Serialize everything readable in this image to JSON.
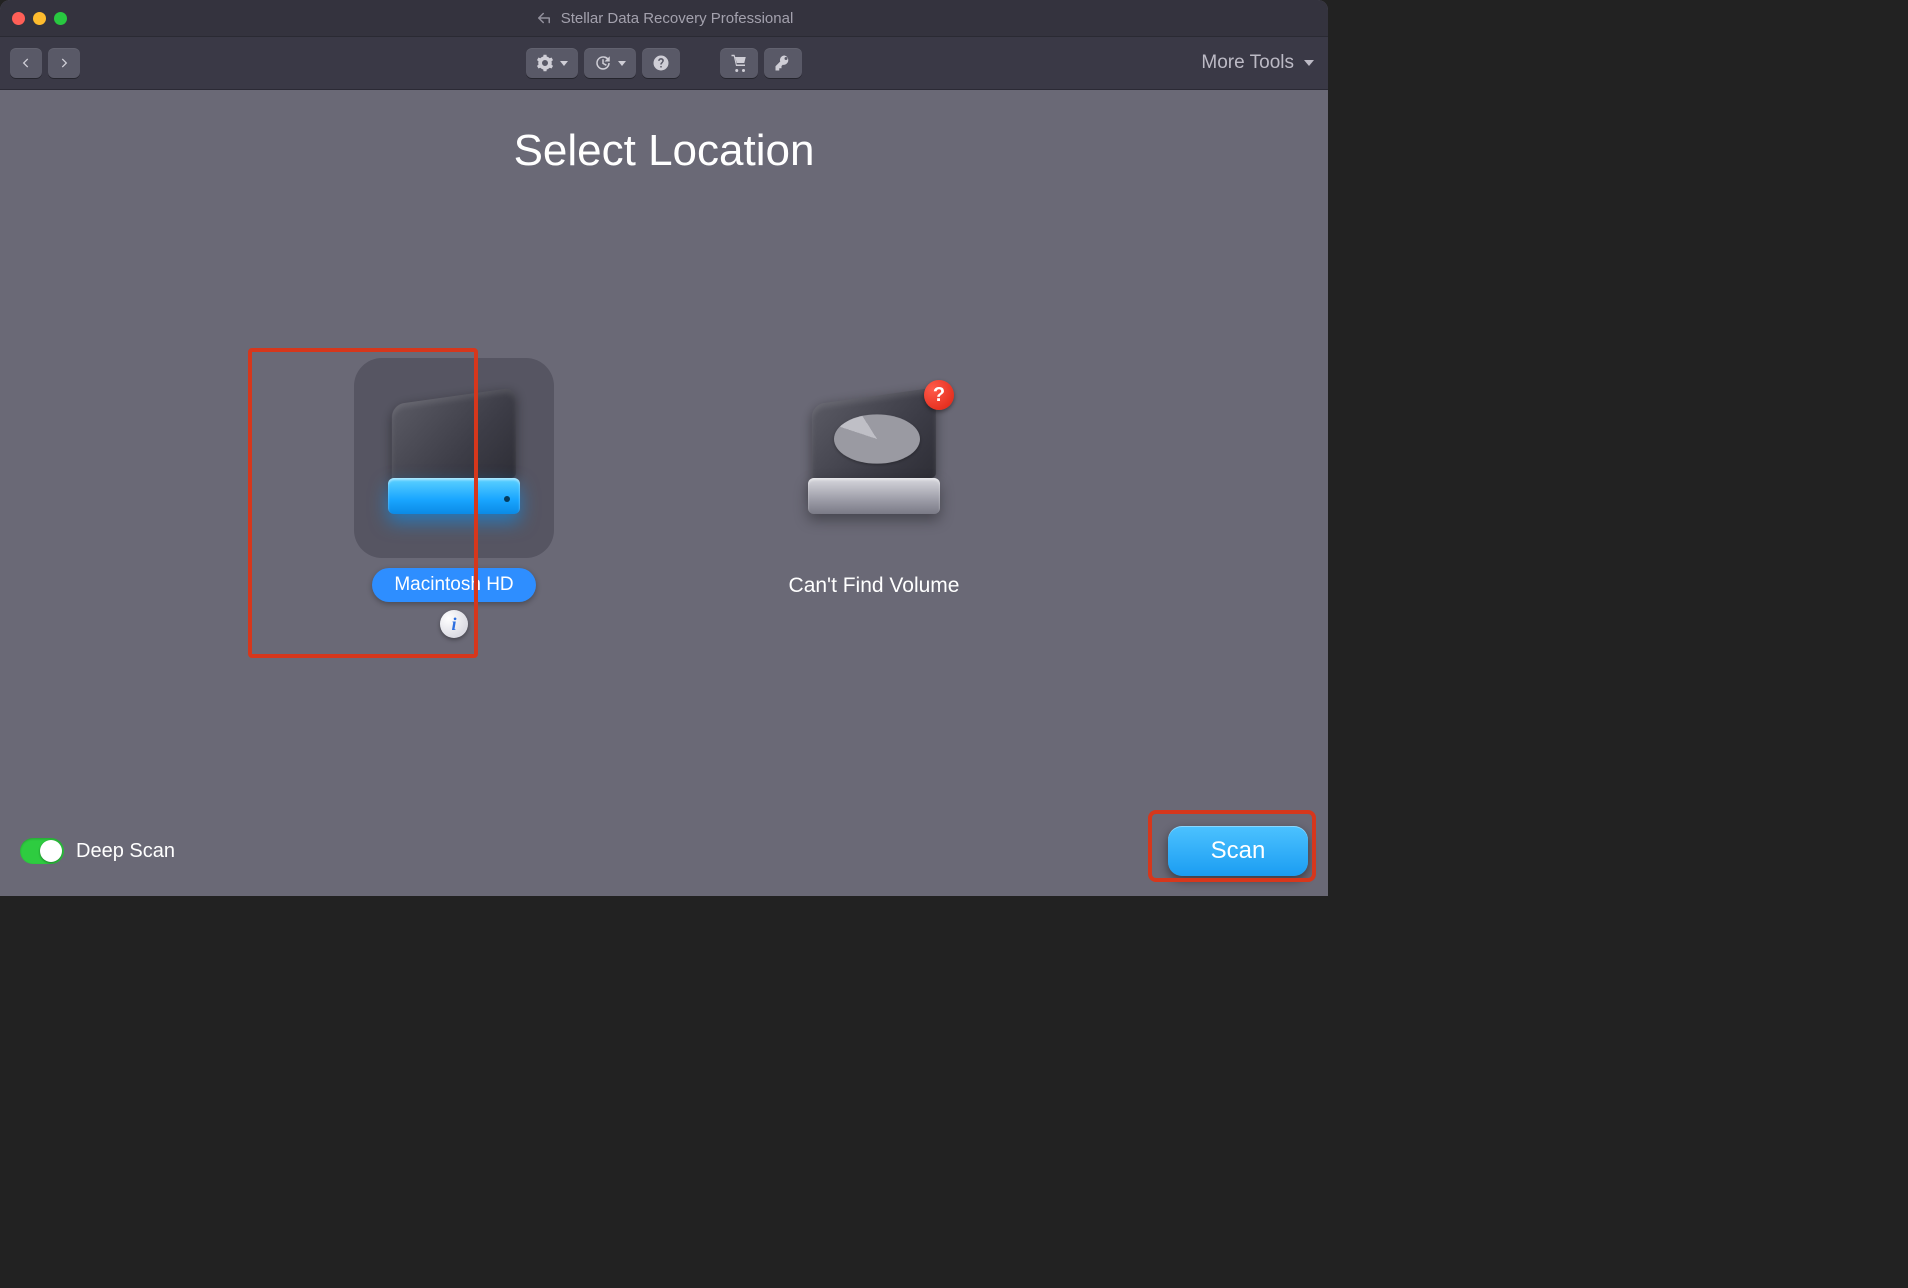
{
  "window": {
    "title": "Stellar Data Recovery Professional"
  },
  "toolbar": {
    "more_tools_label": "More Tools"
  },
  "heading": "Select Location",
  "drives": [
    {
      "label": "Macintosh HD",
      "selected": true,
      "kind": "volume"
    },
    {
      "label": "Can't Find Volume",
      "selected": false,
      "kind": "unknown"
    }
  ],
  "footer": {
    "deep_scan_label": "Deep Scan",
    "deep_scan_on": true,
    "scan_button_label": "Scan"
  },
  "highlights": {
    "drive0": true,
    "scan_button": true
  },
  "colors": {
    "accent_blue": "#2e8eff",
    "scan_blue": "#2aadfa",
    "highlight_red": "#d6371c",
    "toggle_green": "#2ecc40"
  }
}
